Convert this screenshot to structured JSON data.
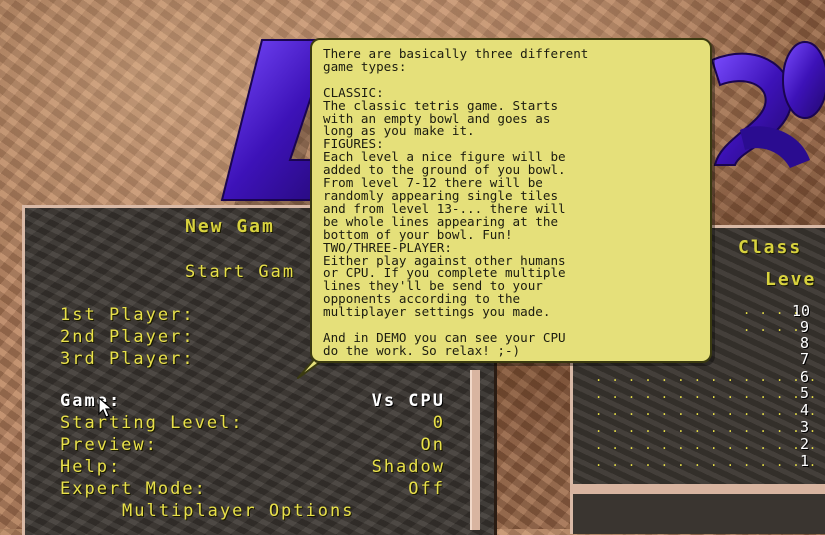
{
  "tooltip": {
    "text": "There are basically three different\ngame types:\n\nCLASSIC:\nThe classic tetris game. Starts\nwith an empty bowl and goes as\nlong as you make it.\nFIGURES:\nEach level a nice figure will be\nadded to the ground of you bowl.\nFrom level 7-12 there will be\nrandomly appearing single tiles\nand from level 13-... there will\nbe whole lines appearing at the\nbottom of your bowl. Fun!\nTWO/THREE-PLAYER:\nEither play against other humans\nor CPU. If you complete multiple\nlines they'll be send to your\nopponents according to the\nmultiplayer settings you made.\n\nAnd in DEMO you can see your CPU\ndo the work. So relax! ;-)"
  },
  "menu": {
    "header": "New Gam",
    "start": "Start Gam",
    "players": [
      "1st Player:",
      "2nd Player:",
      "3rd Player:"
    ],
    "settings": [
      {
        "label": "Game:",
        "value": "Vs CPU"
      },
      {
        "label": "Starting Level:",
        "value": "0"
      },
      {
        "label": "Preview:",
        "value": "On"
      },
      {
        "label": "Help:",
        "value": "Shadow"
      },
      {
        "label": "Expert Mode:",
        "value": "Off"
      }
    ],
    "multiplayer": "Multiplayer Options"
  },
  "scores": {
    "header": "Class",
    "subheader": "Leve",
    "levels": [
      "10",
      "9",
      "8",
      "7",
      "6",
      "5",
      "4",
      "3",
      "2",
      "1"
    ]
  },
  "colors": {
    "menu_text": "#e8e04a",
    "tooltip_bg": "#e5e07a",
    "logo": "#4a1fc8"
  }
}
